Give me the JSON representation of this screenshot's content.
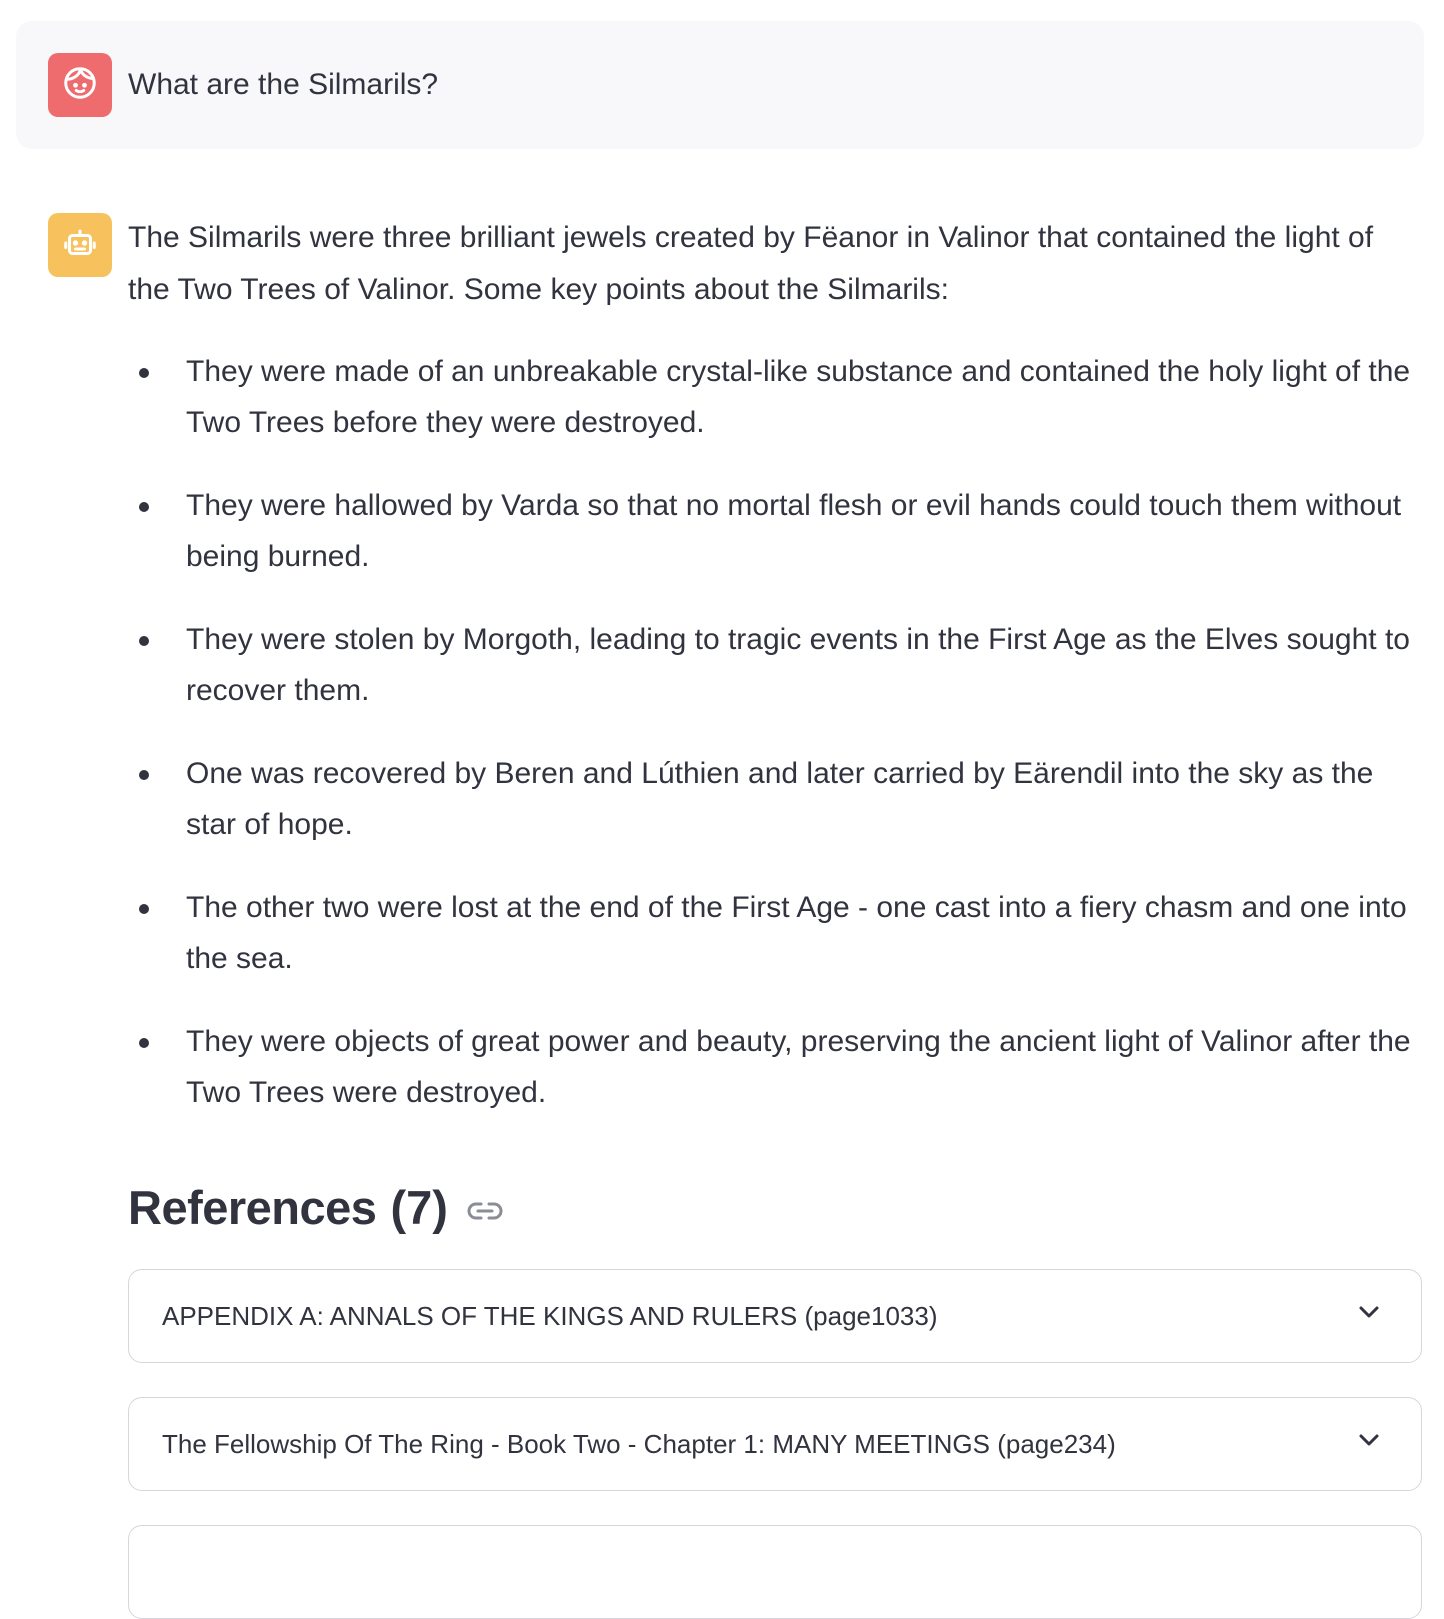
{
  "user_message": {
    "text": "What are the Silmarils?"
  },
  "assistant_message": {
    "intro": "The Silmarils were three brilliant jewels created by Fëanor in Valinor that contained the light of the Two Trees of Valinor. Some key points about the Silmarils:",
    "bullets": [
      "They were made of an unbreakable crystal-like substance and contained the holy light of the Two Trees before they were destroyed.",
      "They were hallowed by Varda so that no mortal flesh or evil hands could touch them without being burned.",
      "They were stolen by Morgoth, leading to tragic events in the First Age as the Elves sought to recover them.",
      "One was recovered by Beren and Lúthien and later carried by Eärendil into the sky as the star of hope.",
      "The other two were lost at the end of the First Age - one cast into a fiery chasm and one into the sea.",
      "They were objects of great power and beauty, preserving the ancient light of Valinor after the Two Trees were destroyed."
    ]
  },
  "references": {
    "title": "References",
    "count": "(7)",
    "items": [
      "APPENDIX A: ANNALS OF THE KINGS AND RULERS (page1033)",
      "The Fellowship Of The Ring - Book Two - Chapter 1: MANY MEETINGS (page234)",
      ""
    ]
  },
  "icons": {
    "user_avatar": "user-face-icon",
    "assistant_avatar": "robot-icon",
    "heading_anchor": "link-icon",
    "expand": "chevron-down-icon"
  },
  "colors": {
    "user_avatar_bg": "#ee6b6e",
    "assistant_avatar_bg": "#f7c25d",
    "user_message_bg": "#f8f8fa",
    "text": "#31333f"
  }
}
